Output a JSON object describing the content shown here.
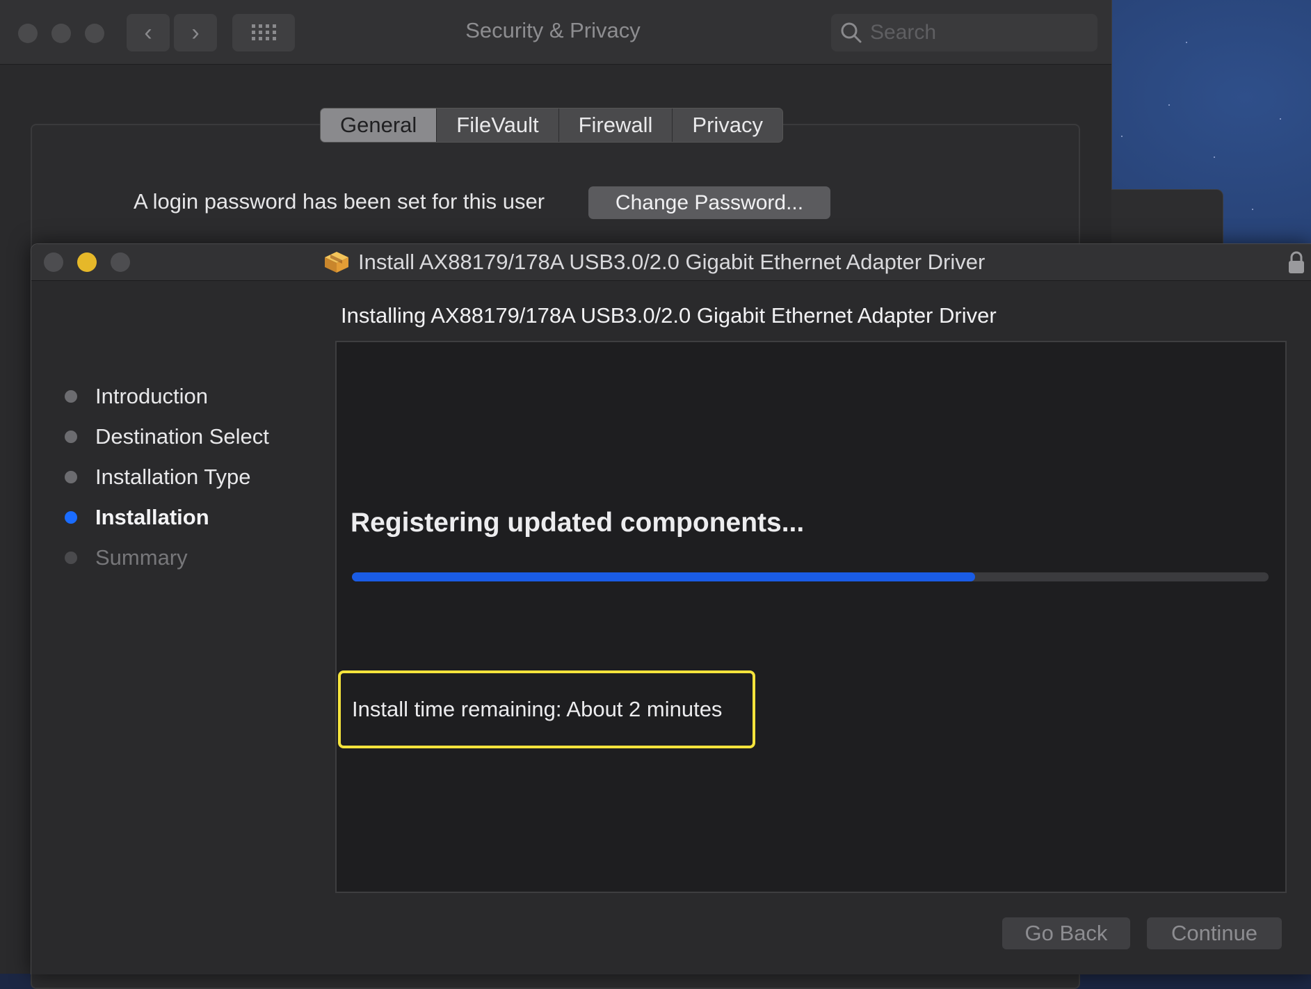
{
  "security_window": {
    "title": "Security & Privacy",
    "nav_back_glyph": "‹",
    "nav_forward_glyph": "›",
    "search_placeholder": "Search",
    "tabs": [
      {
        "label": "General",
        "active": true
      },
      {
        "label": "FileVault",
        "active": false
      },
      {
        "label": "Firewall",
        "active": false
      },
      {
        "label": "Privacy",
        "active": false
      }
    ],
    "login_text": "A login password has been set for this user",
    "change_password_label": "Change Password..."
  },
  "installer_window": {
    "title": "Install AX88179/178A USB3.0/2.0 Gigabit Ethernet Adapter Driver",
    "heading": "Installing AX88179/178A USB3.0/2.0 Gigabit Ethernet Adapter Driver",
    "steps": [
      {
        "label": "Introduction",
        "state": "done"
      },
      {
        "label": "Destination Select",
        "state": "done"
      },
      {
        "label": "Installation Type",
        "state": "done"
      },
      {
        "label": "Installation",
        "state": "current"
      },
      {
        "label": "Summary",
        "state": "future"
      }
    ],
    "status": "Registering updated components...",
    "progress_fraction": 0.68,
    "time_remaining": "Install time remaining: About 2 minutes",
    "go_back_label": "Go Back",
    "continue_label": "Continue"
  },
  "colors": {
    "accent_blue": "#1a5ce5",
    "highlight_yellow": "#f4e33c",
    "minimize_yellow": "#e6b829"
  },
  "icons": [
    "search-icon",
    "package-icon",
    "lock-icon",
    "grid-icon",
    "chevron-left-icon",
    "chevron-right-icon"
  ]
}
